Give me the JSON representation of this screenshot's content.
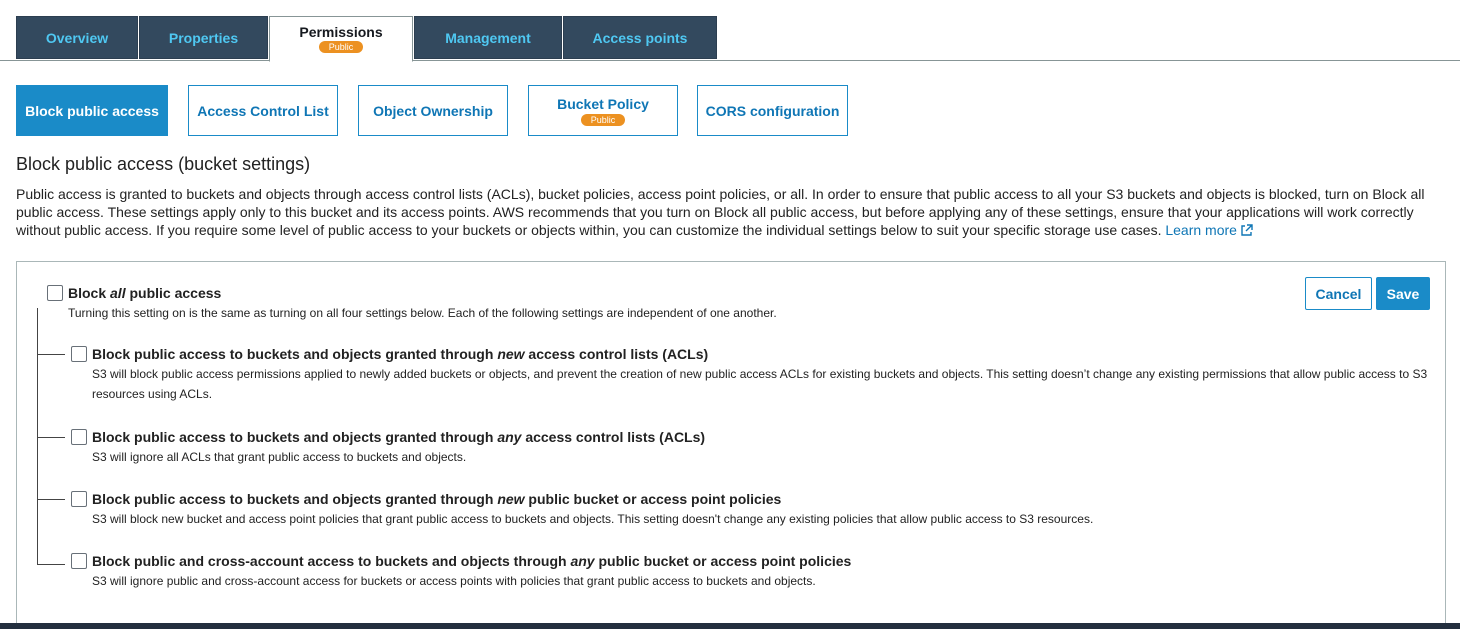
{
  "tabs": [
    {
      "label": "Overview",
      "active": false
    },
    {
      "label": "Properties",
      "active": false
    },
    {
      "label": "Permissions",
      "active": true,
      "badge": "Public"
    },
    {
      "label": "Management",
      "active": false
    },
    {
      "label": "Access points",
      "active": false
    }
  ],
  "subtabs": [
    {
      "label": "Block public access",
      "active": true
    },
    {
      "label": "Access Control List",
      "active": false
    },
    {
      "label": "Object Ownership",
      "active": false
    },
    {
      "label": "Bucket Policy",
      "active": false,
      "badge": "Public"
    },
    {
      "label": "CORS configuration",
      "active": false
    }
  ],
  "section": {
    "title": "Block public access (bucket settings)",
    "description": "Public access is granted to buckets and objects through access control lists (ACLs), bucket policies, access point policies, or all. In order to ensure that public access to all your S3 buckets and objects is blocked, turn on Block all public access. These settings apply only to this bucket and its access points. AWS recommends that you turn on Block all public access, but before applying any of these settings, ensure that your applications will work correctly without public access. If you require some level of public access to your buckets or objects within, you can customize the individual settings below to suit your specific storage use cases.",
    "learn_more": "Learn more"
  },
  "panel": {
    "main": {
      "title_pre": "Block ",
      "title_em": "all",
      "title_post": " public access",
      "checked": false,
      "description": "Turning this setting on is the same as turning on all four settings below. Each of the following settings are independent of one another."
    },
    "options": [
      {
        "title_pre": "Block public access to buckets and objects granted through ",
        "title_em": "new",
        "title_post": " access control lists (ACLs)",
        "checked": false,
        "description": "S3 will block public access permissions applied to newly added buckets or objects, and prevent the creation of new public access ACLs for existing buckets and objects. This setting doesn’t change any existing permissions that allow public access to S3 resources using ACLs."
      },
      {
        "title_pre": "Block public access to buckets and objects granted through ",
        "title_em": "any",
        "title_post": " access control lists (ACLs)",
        "checked": false,
        "description": "S3 will ignore all ACLs that grant public access to buckets and objects."
      },
      {
        "title_pre": "Block public access to buckets and objects granted through ",
        "title_em": "new",
        "title_post": " public bucket or access point policies",
        "checked": false,
        "description": "S3 will block new bucket and access point policies that grant public access to buckets and objects. This setting doesn't change any existing policies that allow public access to S3 resources."
      },
      {
        "title_pre": "Block public and cross-account access to buckets and objects through ",
        "title_em": "any",
        "title_post": " public bucket or access point policies",
        "checked": false,
        "description": "S3 will ignore public and cross-account access for buckets or access points with policies that grant public access to buckets and objects."
      }
    ],
    "cancel_label": "Cancel",
    "save_label": "Save"
  },
  "colors": {
    "tab_bg": "#33495e",
    "tab_text": "#4fc8f2",
    "accent": "#1a8bc8",
    "badge": "#ec9121",
    "link": "#0f76b5"
  }
}
